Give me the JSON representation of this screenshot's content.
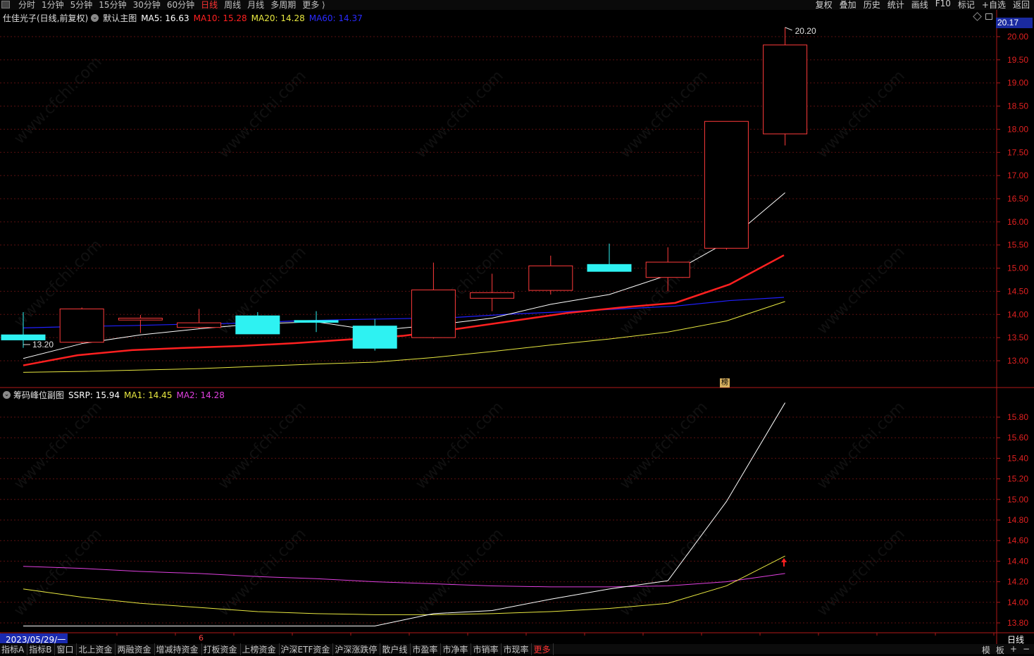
{
  "toolbar": {
    "periods": [
      "分时",
      "1分钟",
      "5分钟",
      "15分钟",
      "30分钟",
      "60分钟",
      "日线",
      "周线",
      "月线",
      "多周期",
      "更多 ⟩"
    ],
    "active_period": "日线",
    "right_menu": [
      "复权",
      "叠加",
      "历史",
      "统计",
      "画线",
      "F10",
      "标记",
      "+自选",
      "返回"
    ]
  },
  "main_panel": {
    "stock_title": "仕佳光子(日线,前复权)",
    "indicator_name": "默认主图",
    "ma5": "MA5: 16.63",
    "ma10": "MA10: 15.28",
    "ma20": "MA20: 14.28",
    "ma60": "MA60: 14.37",
    "current_price_tag": "20.17",
    "high_label": "20.20",
    "low_label": "13.20",
    "marker_badge": "榜",
    "y_ticks": [
      "20.00",
      "19.50",
      "19.00",
      "18.50",
      "18.00",
      "17.50",
      "17.00",
      "16.50",
      "16.00",
      "15.50",
      "15.00",
      "14.50",
      "14.00",
      "13.50",
      "13.00"
    ]
  },
  "sub_panel": {
    "indicator_name": "筹码峰位副图",
    "ssrp": "SSRP: 15.94",
    "ma1": "MA1: 14.45",
    "ma2": "MA2: 14.28",
    "y_ticks": [
      "15.80",
      "15.60",
      "15.40",
      "15.20",
      "15.00",
      "14.80",
      "14.60",
      "14.40",
      "14.20",
      "14.00",
      "13.80"
    ]
  },
  "date_label": "2023/05/29/一",
  "month_marker": "6",
  "period_badge": "日线",
  "bottom_tabs": [
    "指标A",
    "指标B",
    "窗口",
    "北上资金",
    "两融资金",
    "增减持资金",
    "打板资金",
    "上榜资金",
    "沪深ETF资金",
    "沪深涨跌停",
    "散户线",
    "市盈率",
    "市净率",
    "市销率",
    "市现率",
    "更多"
  ],
  "bottom_right": [
    "模",
    "板",
    "+",
    "−"
  ],
  "watermark": "www.cfchi.com",
  "colors": {
    "up": "#ff3b3b",
    "down": "#2ef2f2",
    "ma5": "#ffffff",
    "ma10": "#ff2020",
    "ma20": "#e8e840",
    "ma60": "#2020ff",
    "ma1": "#e8e840",
    "ma2": "#e040e0"
  },
  "chart_data": {
    "type": "candlestick",
    "main": {
      "candles": [
        {
          "o": 13.56,
          "c": 13.45,
          "h": 14.05,
          "l": 13.28
        },
        {
          "o": 13.4,
          "c": 14.12,
          "h": 14.15,
          "l": 13.38
        },
        {
          "o": 13.88,
          "c": 13.92,
          "h": 13.99,
          "l": 13.6
        },
        {
          "o": 13.72,
          "c": 13.82,
          "h": 14.12,
          "l": 13.7
        },
        {
          "o": 13.97,
          "c": 13.58,
          "h": 14.05,
          "l": 13.58
        },
        {
          "o": 13.87,
          "c": 13.83,
          "h": 14.07,
          "l": 13.62
        },
        {
          "o": 13.75,
          "c": 13.27,
          "h": 13.9,
          "l": 13.22
        },
        {
          "o": 13.5,
          "c": 14.53,
          "h": 15.12,
          "l": 13.48
        },
        {
          "o": 14.35,
          "c": 14.47,
          "h": 14.88,
          "l": 14.07
        },
        {
          "o": 14.52,
          "c": 15.05,
          "h": 15.27,
          "l": 14.43
        },
        {
          "o": 15.08,
          "c": 14.93,
          "h": 15.53,
          "l": 14.93
        },
        {
          "o": 14.8,
          "c": 15.13,
          "h": 15.45,
          "l": 14.5
        },
        {
          "o": 15.43,
          "c": 18.17,
          "h": 18.17,
          "l": 15.4
        },
        {
          "o": 17.9,
          "c": 19.82,
          "h": 20.2,
          "l": 17.65
        }
      ],
      "ma5": [
        13.05,
        13.37,
        13.56,
        13.69,
        13.8,
        13.84,
        13.65,
        13.77,
        13.92,
        14.22,
        14.43,
        14.85,
        15.56,
        16.63
      ],
      "ma10": [
        12.9,
        13.12,
        13.23,
        13.28,
        13.32,
        13.38,
        13.46,
        13.54,
        13.69,
        13.86,
        14.03,
        14.15,
        14.25,
        14.65,
        15.28
      ],
      "ma20": [
        12.75,
        12.77,
        12.8,
        12.83,
        12.88,
        12.93,
        12.97,
        13.07,
        13.2,
        13.34,
        13.47,
        13.62,
        13.86,
        14.28
      ],
      "ma60": [
        13.71,
        13.74,
        13.76,
        13.79,
        13.81,
        13.86,
        13.89,
        13.91,
        13.94,
        14.01,
        14.06,
        14.12,
        14.18,
        14.3,
        14.37
      ]
    },
    "sub": {
      "ssrp": [
        13.77,
        13.77,
        13.77,
        13.77,
        13.77,
        13.77,
        13.77,
        13.89,
        13.92,
        14.03,
        14.13,
        14.21,
        14.98,
        15.94
      ],
      "ma1": [
        14.13,
        14.05,
        13.99,
        13.95,
        13.91,
        13.89,
        13.88,
        13.88,
        13.89,
        13.91,
        13.94,
        13.99,
        14.16,
        14.45
      ],
      "ma2": [
        14.35,
        14.33,
        14.3,
        14.28,
        14.25,
        14.23,
        14.2,
        14.18,
        14.16,
        14.15,
        14.15,
        14.16,
        14.2,
        14.28
      ]
    },
    "ylim_main": [
      12.6,
      20.3
    ],
    "ylim_sub": [
      13.7,
      15.95
    ]
  }
}
